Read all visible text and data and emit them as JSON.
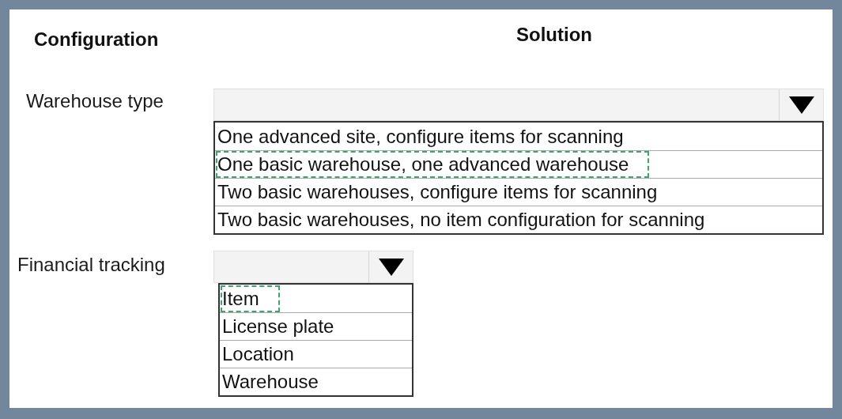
{
  "columns": [
    "Configuration",
    "Solution"
  ],
  "settings": [
    {
      "label": "Warehouse type",
      "options": [
        {
          "text": "One advanced site, configure items for scanning",
          "selected": false
        },
        {
          "text": "One basic warehouse, one advanced warehouse",
          "selected": true
        },
        {
          "text": "Two basic warehouses, configure items for scanning",
          "selected": false
        },
        {
          "text": "Two basic warehouses, no item configuration for scanning",
          "selected": false
        }
      ]
    },
    {
      "label": "Financial tracking",
      "options": [
        {
          "text": "Item",
          "selected": true
        },
        {
          "text": "License plate",
          "selected": false
        },
        {
          "text": "Location",
          "selected": false
        },
        {
          "text": "Warehouse",
          "selected": false
        }
      ]
    }
  ]
}
